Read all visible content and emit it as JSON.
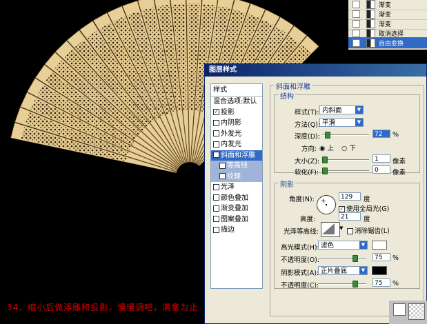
{
  "history": {
    "items": [
      {
        "label": "渐变",
        "selected": false
      },
      {
        "label": "渐变",
        "selected": false
      },
      {
        "label": "渐变",
        "selected": false
      },
      {
        "label": "取消选择",
        "selected": false
      },
      {
        "label": "自由变换",
        "selected": true
      }
    ]
  },
  "dialog": {
    "title": "图层样式",
    "styles_header": "样式",
    "blend_options": "混合选项:默认",
    "styles": [
      {
        "label": "投影",
        "checked": true
      },
      {
        "label": "内阴影",
        "checked": false
      },
      {
        "label": "外发光",
        "checked": false
      },
      {
        "label": "内发光",
        "checked": false
      },
      {
        "label": "斜面和浮雕",
        "checked": true,
        "selected": true
      },
      {
        "label": "等高线",
        "checked": false,
        "sub": true
      },
      {
        "label": "纹理",
        "checked": false,
        "sub": true
      },
      {
        "label": "光泽",
        "checked": false
      },
      {
        "label": "颜色叠加",
        "checked": false
      },
      {
        "label": "渐变叠加",
        "checked": false
      },
      {
        "label": "图案叠加",
        "checked": false
      },
      {
        "label": "描边",
        "checked": false
      }
    ],
    "section_title": "斜面和浮雕",
    "structure": {
      "title": "结构",
      "style_label": "样式(T):",
      "style_value": "内斜面",
      "technique_label": "方法(Q):",
      "technique_value": "平滑",
      "depth_label": "深度(D):",
      "depth_value": "72",
      "depth_unit": "%",
      "direction_label": "方向:",
      "dir_up": "上",
      "dir_down": "下",
      "size_label": "大小(Z):",
      "size_value": "1",
      "size_unit": "像素",
      "soften_label": "软化(F):",
      "soften_value": "0",
      "soften_unit": "像素"
    },
    "shading": {
      "title": "阴影",
      "angle_label": "角度(N):",
      "angle_value": "129",
      "angle_unit": "度",
      "global_light": "使用全局光(G)",
      "altitude_label": "高度:",
      "altitude_value": "21",
      "altitude_unit": "度",
      "gloss_label": "光泽等高线:",
      "anti_alias": "消除锯齿(L)",
      "highlight_mode_label": "高光模式(H):",
      "highlight_mode_value": "滤色",
      "highlight_color": "#ffffff",
      "highlight_opacity_label": "不透明度(O):",
      "highlight_opacity_value": "75",
      "shadow_mode_label": "阴影模式(A):",
      "shadow_mode_value": "正片叠底",
      "shadow_color": "#000000",
      "shadow_opacity_label": "不透明度(C):",
      "shadow_opacity_value": "75",
      "percent": "%"
    }
  },
  "caption": "34、缩小后做浮雕和投影，慢慢调吧，满意为止"
}
